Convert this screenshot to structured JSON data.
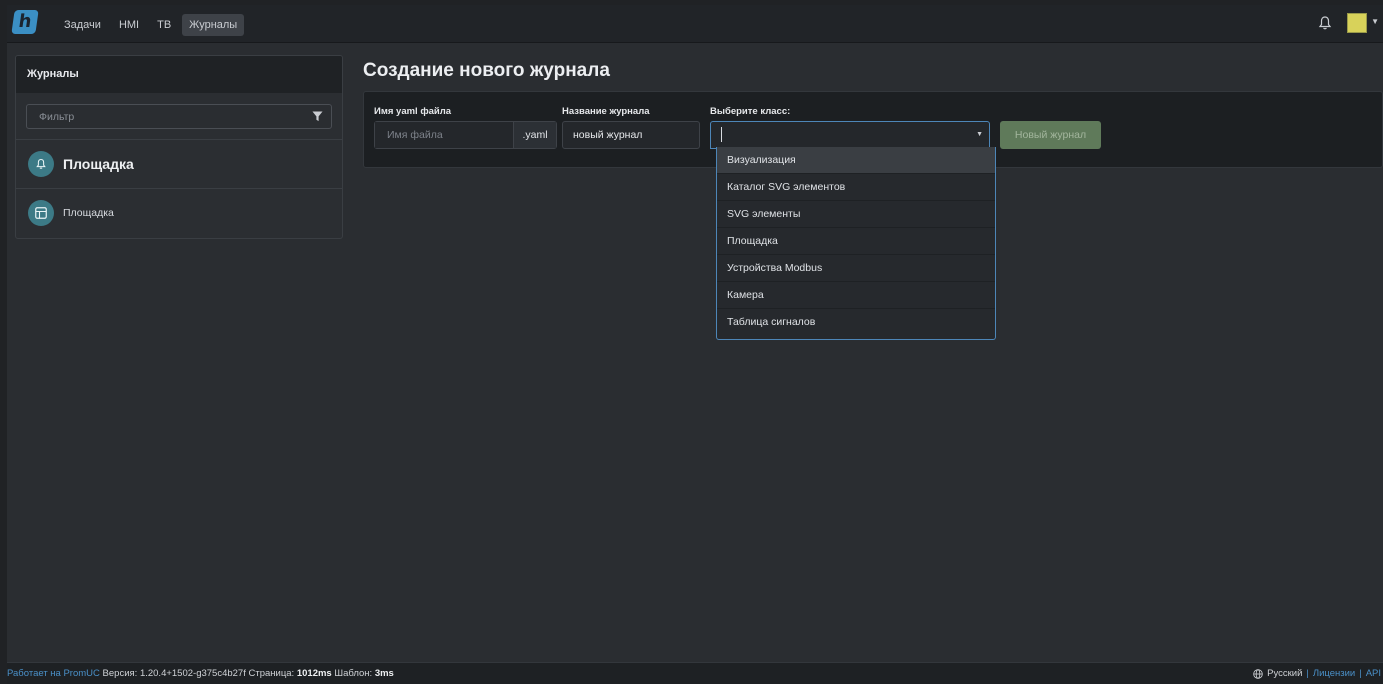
{
  "nav": {
    "logo_text": "h",
    "items": [
      {
        "label": "Задачи",
        "active": false
      },
      {
        "label": "HMI",
        "active": false
      },
      {
        "label": "TB",
        "active": false
      },
      {
        "label": "Журналы",
        "active": true
      }
    ],
    "icons": [
      "bell-icon",
      "avatar-icon"
    ]
  },
  "sidebar": {
    "title": "Журналы",
    "filter_placeholder": "Фильтр",
    "group": {
      "label": "Площадка",
      "icon": "bell-icon"
    },
    "items": [
      {
        "label": "Площадка",
        "icon": "table-icon"
      }
    ]
  },
  "form": {
    "page_title": "Создание нового журнала",
    "yaml_label": "Имя yaml файла",
    "yaml_placeholder": "Имя файла",
    "yaml_suffix": ".yaml",
    "name_label": "Название журнала",
    "name_value": "новый журнал",
    "class_label": "Выберите класс:",
    "class_value": "",
    "submit_label": "Новый журнал",
    "class_options": [
      "Визуализация",
      "Каталог SVG элементов",
      "SVG элементы",
      "Площадка",
      "Устройства Modbus",
      "Камера",
      "Таблица сигналов"
    ],
    "highlighted_option": "Визуализация"
  },
  "footer": {
    "powered": "Работает на PromUC",
    "version_label": "Версия:",
    "version": "1.20.4+1502-g375c4b27f",
    "page_label": "Страница:",
    "page_time": "1012ms",
    "template_label": "Шаблон:",
    "template_time": "3ms",
    "language": "Русский",
    "licenses": "Лицензии",
    "api": "API"
  },
  "colors": {
    "accent": "#4d86b8",
    "button": "#5f7a5a",
    "circle": "#3c7a86",
    "logo": "#3b8fc4"
  }
}
